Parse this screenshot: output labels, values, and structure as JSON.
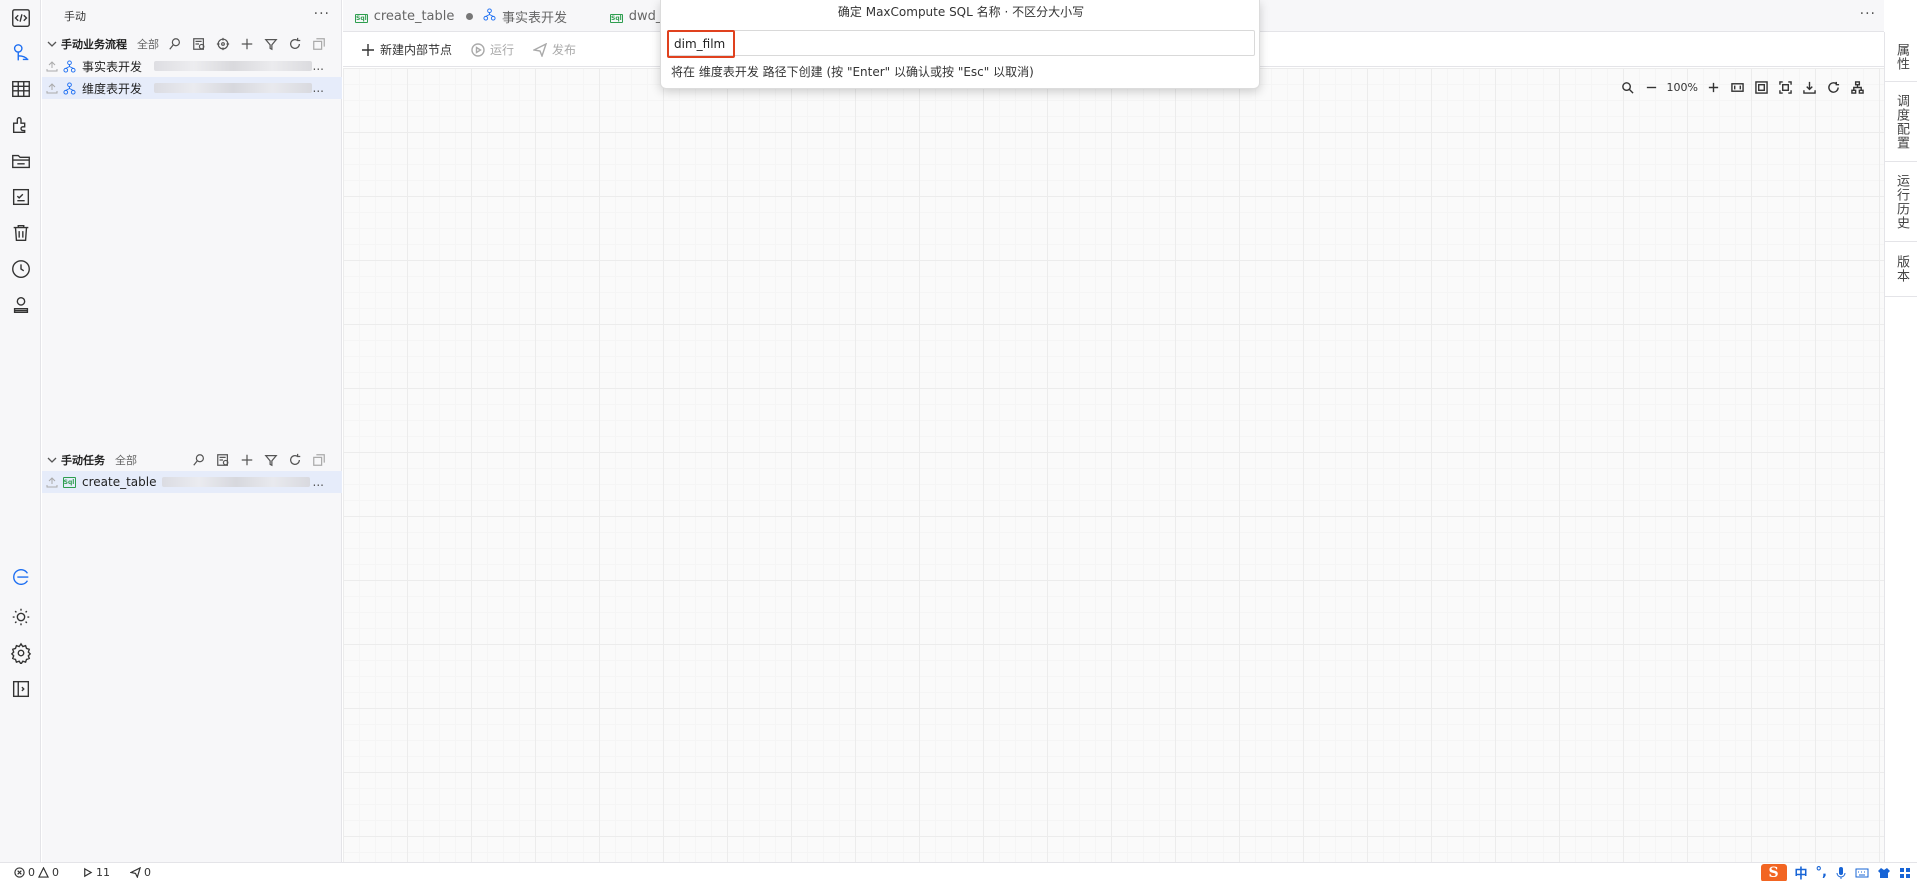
{
  "sidebar": {
    "title": "手动",
    "more": "···",
    "workflow_section": {
      "title": "手动业务流程",
      "filter": "全部",
      "items": [
        {
          "label": "事实表开发",
          "suffix": "..."
        },
        {
          "label": "维度表开发",
          "suffix": "..."
        }
      ]
    },
    "task_section": {
      "title": "手动任务",
      "filter": "全部",
      "items": [
        {
          "label": "create_table",
          "badge": "Sql",
          "suffix": "..."
        }
      ]
    }
  },
  "tabs": {
    "items": [
      {
        "label": "create_table",
        "icon": "sql-file-icon",
        "modified": true
      },
      {
        "label": "事实表开发",
        "icon": "workflow-icon"
      },
      {
        "label": "dwd_",
        "icon": "sql-file-icon"
      }
    ],
    "more": "···"
  },
  "toolbar": {
    "new_node": "新建内部节点",
    "run": "运行",
    "publish": "发布"
  },
  "canvas": {
    "zoom": "100%"
  },
  "right_panel": {
    "tabs": [
      "属性",
      "调度配置",
      "运行历史",
      "版本"
    ]
  },
  "quick_input": {
    "title": "确定 MaxCompute SQL 名称 · 不区分大小写",
    "value": "dim_film",
    "hint": "将在 维度表开发 路径下创建 (按 \"Enter\" 以确认或按 \"Esc\" 以取消)"
  },
  "status_bar": {
    "errors": "0",
    "warnings": "0",
    "runs": "11",
    "publishes": "0",
    "ime_logo": "S",
    "ime_lang": "中"
  },
  "colors": {
    "accent": "#1c6ef2",
    "highlight_border": "#e0411e",
    "sql_green": "#2e9e4f",
    "selected_row": "#e6ecfa"
  }
}
